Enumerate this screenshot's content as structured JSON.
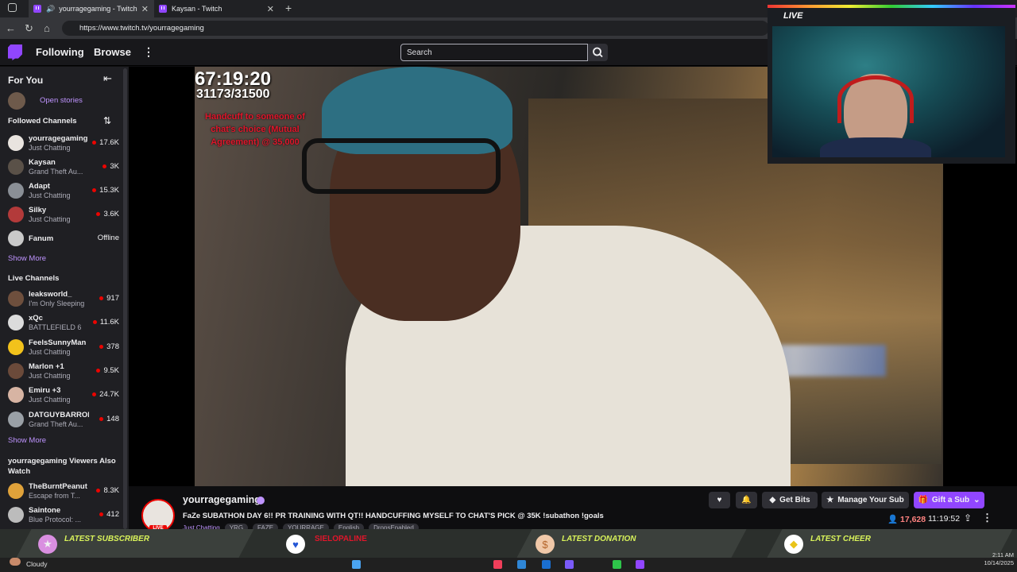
{
  "browser": {
    "tabs": [
      {
        "title": "yourragegaming - Twitch",
        "active": true
      },
      {
        "title": "Kaysan - Twitch",
        "active": false
      }
    ],
    "url": "https://www.twitch.tv/yourragegaming"
  },
  "topnav": {
    "following": "Following",
    "browse": "Browse",
    "search_placeholder": "Search"
  },
  "sidebar": {
    "for_you": "For You",
    "open_stories": "Open stories",
    "followed_header": "Followed Channels",
    "followed": [
      {
        "name": "yourragegaming",
        "game": "Just Chatting",
        "viewers": "17.6K",
        "color": "#e9e4df"
      },
      {
        "name": "Kaysan",
        "game": "Grand Theft Au...",
        "viewers": "3K",
        "color": "#5a5148"
      },
      {
        "name": "Adapt",
        "game": "Just Chatting",
        "viewers": "15.3K",
        "color": "#8a8f96"
      },
      {
        "name": "Silky",
        "game": "Just Chatting",
        "viewers": "3.6K",
        "color": "#b33a3a"
      },
      {
        "name": "Fanum",
        "game": "",
        "viewers": "Offline",
        "color": "#c9c9c9"
      }
    ],
    "show_more_1": "Show More",
    "live_header": "Live Channels",
    "live": [
      {
        "name": "leaksworld_",
        "game": "I'm Only Sleeping",
        "viewers": "917",
        "color": "#6e4f3d"
      },
      {
        "name": "xQc",
        "game": "BATTLEFIELD 6",
        "viewers": "11.6K",
        "color": "#dcdcdc"
      },
      {
        "name": "FeelsSunnyMan",
        "game": "Just Chatting",
        "viewers": "378",
        "color": "#f2c21b"
      },
      {
        "name": "Marlon +1",
        "game": "Just Chatting",
        "viewers": "9.5K",
        "color": "#6b4a3a"
      },
      {
        "name": "Emiru +3",
        "game": "Just Chatting",
        "viewers": "24.7K",
        "color": "#d7b4a3"
      },
      {
        "name": "DATGUYBARRON",
        "game": "Grand Theft Au...",
        "viewers": "148",
        "color": "#9aa0a6"
      }
    ],
    "show_more_2": "Show More",
    "also_watch_header": "yourragegaming Viewers Also Watch",
    "also_watch": [
      {
        "name": "TheBurntPeanut",
        "game": "Escape from T...",
        "viewers": "8.3K",
        "color": "#e0a23a"
      },
      {
        "name": "Saintone",
        "game": "Blue Protocol: ...",
        "viewers": "412",
        "color": "#bcbcbc"
      }
    ]
  },
  "overlay": {
    "timer": "67:19:20",
    "progress": "31173/31500",
    "goal_text": "Handcuff to someone of chat's choice (Mutual Agreement) @ 35,000",
    "cam_live": "LIVE"
  },
  "stream": {
    "streamer": "yourragegaming",
    "title": "FaZe SUBATHON DAY 6!! PR TRAINING WITH QT!! HANDCUFFING MYSELF TO CHAT'S PICK @ 35K !subathon !goals",
    "category": "Just Chatting",
    "tags": [
      "YRG",
      "FAZE",
      "YOURRAGE",
      "English",
      "DropsEnabled"
    ],
    "live_badge": "LIVE",
    "viewers": "17,628",
    "uptime": "11:19:52",
    "buttons": {
      "get_bits": "Get Bits",
      "manage_sub": "Manage Your Sub",
      "gift_sub": "Gift a Sub"
    }
  },
  "alerts": {
    "latest_subscriber": "LATEST SUBSCRIBER",
    "latest_follower_value": "SIELOPALINE",
    "latest_donation": "LATEST DONATION",
    "latest_cheer": "LATEST CHEER"
  },
  "taskbar": {
    "weather": "Cloudy",
    "time": "2:11 AM",
    "date": "10/14/2025"
  },
  "colors": {
    "accent": "#9146ff",
    "live_red": "#eb0400",
    "alert_green": "#d8f25a"
  }
}
